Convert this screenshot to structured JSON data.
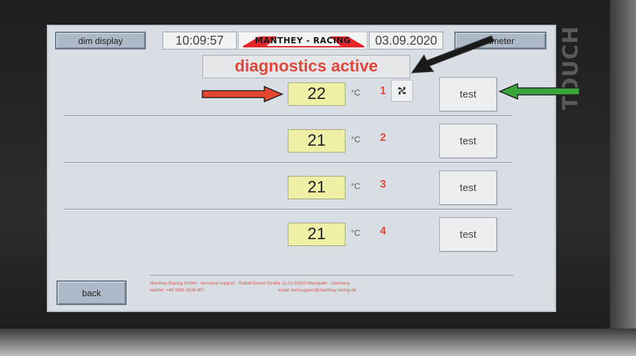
{
  "device": {
    "side_label": "TOUCH"
  },
  "header": {
    "dim_label": "dim display",
    "time": "10:09:57",
    "logo_text": "MANTHEY - RACING",
    "date": "03.09.2020",
    "param_label": "ameter"
  },
  "banner": {
    "text": "diagnostics active"
  },
  "rows": [
    {
      "temp": "22",
      "unit": "°C",
      "num": "1",
      "test_label": "test",
      "fan_icon": "fan-icon"
    },
    {
      "temp": "21",
      "unit": "°C",
      "num": "2",
      "test_label": "test"
    },
    {
      "temp": "21",
      "unit": "°C",
      "num": "3",
      "test_label": "test"
    },
    {
      "temp": "21",
      "unit": "°C",
      "num": "4",
      "test_label": "test"
    }
  ],
  "footer": {
    "back_label": "back",
    "line1": "Manthey-Racing GmbH · technical support · Rudolf-Diesel-Straße 11-13 53520 Meuspath · Germany",
    "phone": "telefon: +49 2691 9338 807",
    "email": "email: techsupport@manthey-racing.de"
  },
  "colors": {
    "screen_bg": "#d9dde4",
    "temp_bg": "#eef0a6",
    "accent_red": "#e0463a",
    "arrow_red": "#e2462e",
    "arrow_green": "#3aa53a",
    "arrow_black": "#1a1a1a"
  }
}
